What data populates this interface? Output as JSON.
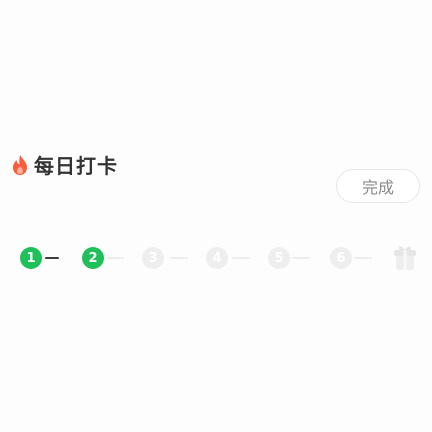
{
  "header": {
    "title": "每日打卡"
  },
  "done_button": {
    "label": "完成"
  },
  "steps": [
    {
      "number": "1",
      "state": "done"
    },
    {
      "number": "2",
      "state": "done"
    },
    {
      "number": "3",
      "state": "todo"
    },
    {
      "number": "4",
      "state": "todo"
    },
    {
      "number": "5",
      "state": "todo"
    },
    {
      "number": "6",
      "state": "todo"
    }
  ],
  "icons": {
    "flame": "flame-icon",
    "gift": "gift-icon"
  },
  "colors": {
    "done": "#1fbf5a",
    "todo": "#eeeeee",
    "flame": "#ff5a3c"
  }
}
